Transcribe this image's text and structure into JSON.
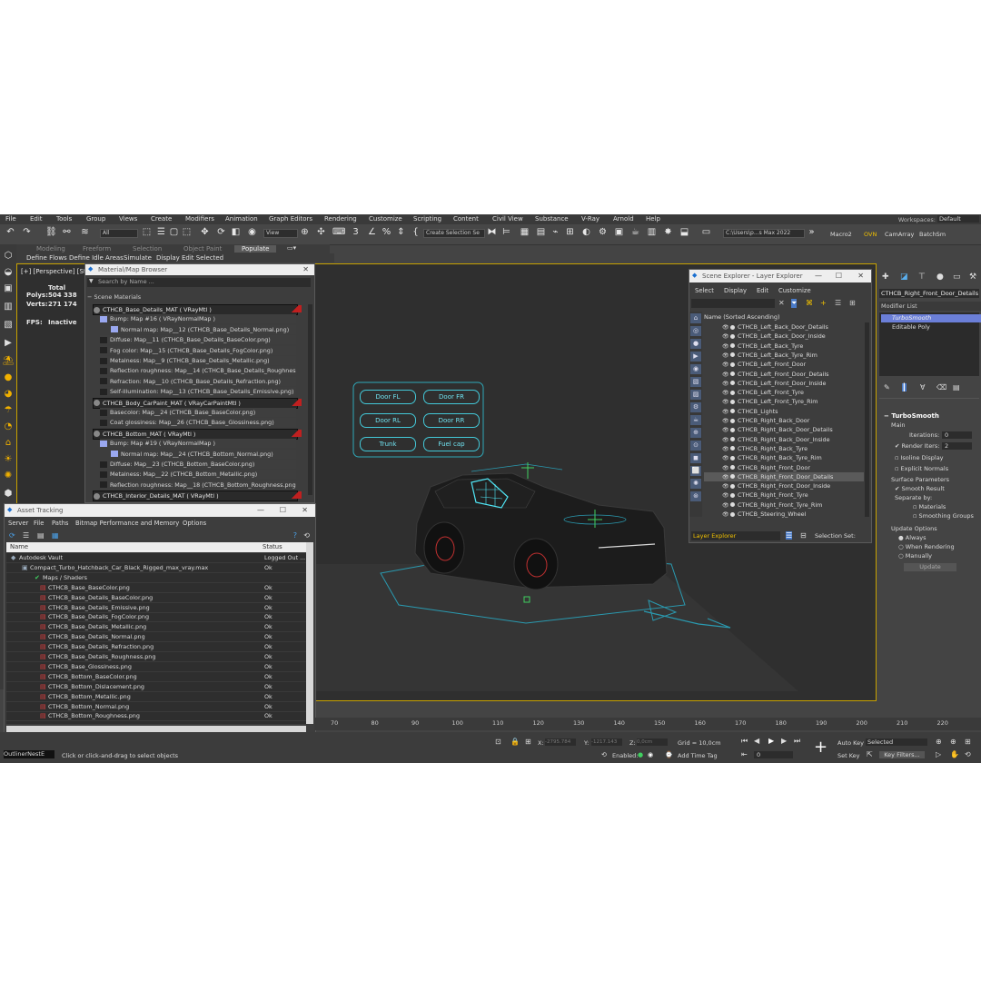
{
  "menu": [
    "File",
    "Edit",
    "Tools",
    "Group",
    "Views",
    "Create",
    "Modifiers",
    "Animation",
    "Graph Editors",
    "Rendering",
    "Customize",
    "Scripting",
    "Content",
    "Civil View",
    "Substance",
    "V-Ray",
    "Arnold",
    "Help"
  ],
  "workspaces": {
    "label": "Workspaces:",
    "value": "Default"
  },
  "toolbar": {
    "filter": "All",
    "refcoord": "View",
    "selset": "Create Selection Se",
    "path": "C:\\Users\\p...s Max 2022",
    "macro": "Macro2",
    "ovn": "OVN",
    "camarray": "CamArray",
    "batchsm": "BatchSm"
  },
  "ribbon": {
    "tabs": [
      "Modeling",
      "Freeform",
      "Selection",
      "Object Paint",
      "Populate"
    ],
    "sub": [
      "Define Flows",
      "Define Idle Areas",
      "Simulate",
      "Display",
      "Edit Selected"
    ]
  },
  "viewport": {
    "label": "[+] [Perspective] [St",
    "stats": {
      "total_label": "Total",
      "polys_label": "Polys:",
      "polys": "504 338",
      "verts_label": "Verts:",
      "verts": "271 174",
      "fps_label": "FPS:",
      "fps": "Inactive"
    },
    "controls": [
      "Door FL",
      "Door FR",
      "Door RL",
      "Door RR",
      "Trunk",
      "Fuel cap"
    ]
  },
  "material_browser": {
    "title": "Material/Map Browser",
    "search_placeholder": "Search by Name ...",
    "group": "Scene Materials",
    "rows": [
      {
        "type": "mat",
        "text": "CTHCB_Base_Details_MAT  ( VRayMtl )"
      },
      {
        "type": "map",
        "text": "Bump: Map #16  ( VRayNormalMap )"
      },
      {
        "type": "map",
        "text": "Normal map: Map__12 (CTHCB_Base_Details_Normal.png)"
      },
      {
        "type": "map",
        "text": "Diffuse: Map__11 (CTHCB_Base_Details_BaseColor.png)"
      },
      {
        "type": "map",
        "text": "Fog color: Map__15 (CTHCB_Base_Details_FogColor.png)"
      },
      {
        "type": "map",
        "text": "Metalness: Map__9 (CTHCB_Base_Details_Metallic.png)"
      },
      {
        "type": "map",
        "text": "Reflection roughness: Map__14 (CTHCB_Base_Details_Roughness..."
      },
      {
        "type": "map",
        "text": "Refraction: Map__10 (CTHCB_Base_Details_Refraction.png)"
      },
      {
        "type": "map",
        "text": "Self-illumination: Map__13 (CTHCB_Base_Details_Emissive.png)"
      },
      {
        "type": "mat",
        "text": "CTHCB_Body_CarPaint_MAT  ( VRayCarPaintMtl )"
      },
      {
        "type": "map",
        "text": "Basecolor: Map__24 (CTHCB_Base_BaseColor.png)"
      },
      {
        "type": "map",
        "text": "Coat glossiness: Map__26 (CTHCB_Base_Glossiness.png)"
      },
      {
        "type": "mat",
        "text": "CTHCB_Bottom_MAT  ( VRayMtl )"
      },
      {
        "type": "map",
        "text": "Bump: Map #19  ( VRayNormalMap )"
      },
      {
        "type": "map",
        "text": "Normal map: Map__24 (CTHCB_Bottom_Normal.png)"
      },
      {
        "type": "map",
        "text": "Diffuse: Map__23 (CTHCB_Bottom_BaseColor.png)"
      },
      {
        "type": "map",
        "text": "Metalness: Map__22 (CTHCB_Bottom_Metallic.png)"
      },
      {
        "type": "map",
        "text": "Reflection roughness: Map__18 (CTHCB_Bottom_Roughness.png)"
      },
      {
        "type": "mat",
        "text": "CTHCB_Interior_Details_MAT  ( VRayMtl )"
      }
    ]
  },
  "asset_tracking": {
    "title": "Asset Tracking",
    "menu": [
      "Server",
      "File",
      "Paths",
      "Bitmap Performance and Memory",
      "Options"
    ],
    "col_name": "Name",
    "col_status": "Status",
    "rows": [
      {
        "name": "Autodesk Vault",
        "status": "Logged Out ..."
      },
      {
        "name": "Compact_Turbo_Hatchback_Car_Black_Rigged_max_vray.max",
        "status": "Ok"
      },
      {
        "name": "Maps / Shaders",
        "status": ""
      },
      {
        "name": "CTHCB_Base_BaseColor.png",
        "status": "Ok"
      },
      {
        "name": "CTHCB_Base_Details_BaseColor.png",
        "status": "Ok"
      },
      {
        "name": "CTHCB_Base_Details_Emissive.png",
        "status": "Ok"
      },
      {
        "name": "CTHCB_Base_Details_FogColor.png",
        "status": "Ok"
      },
      {
        "name": "CTHCB_Base_Details_Metallic.png",
        "status": "Ok"
      },
      {
        "name": "CTHCB_Base_Details_Normal.png",
        "status": "Ok"
      },
      {
        "name": "CTHCB_Base_Details_Refraction.png",
        "status": "Ok"
      },
      {
        "name": "CTHCB_Base_Details_Roughness.png",
        "status": "Ok"
      },
      {
        "name": "CTHCB_Base_Glossiness.png",
        "status": "Ok"
      },
      {
        "name": "CTHCB_Bottom_BaseColor.png",
        "status": "Ok"
      },
      {
        "name": "CTHCB_Bottom_Dislacement.png",
        "status": "Ok"
      },
      {
        "name": "CTHCB_Bottom_Metallic.png",
        "status": "Ok"
      },
      {
        "name": "CTHCB_Bottom_Normal.png",
        "status": "Ok"
      },
      {
        "name": "CTHCB_Bottom_Roughness.png",
        "status": "Ok"
      }
    ]
  },
  "scene_explorer": {
    "title": "Scene Explorer - Layer Explorer",
    "menu": [
      "Select",
      "Display",
      "Edit",
      "Customize"
    ],
    "header": "Name (Sorted Ascending)",
    "selected": "CTHCB_Right_Front_Door_Details",
    "items": [
      "CTHCB_Left_Back_Door_Details",
      "CTHCB_Left_Back_Door_Inside",
      "CTHCB_Left_Back_Tyre",
      "CTHCB_Left_Back_Tyre_Rim",
      "CTHCB_Left_Front_Door",
      "CTHCB_Left_Front_Door_Details",
      "CTHCB_Left_Front_Door_Inside",
      "CTHCB_Left_Front_Tyre",
      "CTHCB_Left_Front_Tyre_Rim",
      "CTHCB_Lights",
      "CTHCB_Right_Back_Door",
      "CTHCB_Right_Back_Door_Details",
      "CTHCB_Right_Back_Door_Inside",
      "CTHCB_Right_Back_Tyre",
      "CTHCB_Right_Back_Tyre_Rim",
      "CTHCB_Right_Front_Door",
      "CTHCB_Right_Front_Door_Details",
      "CTHCB_Right_Front_Door_Inside",
      "CTHCB_Right_Front_Tyre",
      "CTHCB_Right_Front_Tyre_Rim",
      "CTHCB_Steering_Wheel"
    ],
    "footer_layer": "Layer Explorer",
    "footer_selset": "Selection Set:"
  },
  "command_panel": {
    "object_name": "CTHCB_Right_Front_Door_Details",
    "modifier_list": "Modifier List",
    "stack": [
      "TurboSmooth",
      "Editable Poly"
    ],
    "rollout": "TurboSmooth",
    "main": "Main",
    "iterations_label": "Iterations:",
    "iterations": "0",
    "render_iters_label": "Render Iters:",
    "render_iters": "2",
    "isoline": "Isoline Display",
    "explicit": "Explicit Normals",
    "surface": "Surface Parameters",
    "smooth_result": "Smooth Result",
    "separate": "Separate by:",
    "materials": "Materials",
    "smoothing_groups": "Smoothing Groups",
    "update_options": "Update Options",
    "always": "Always",
    "when_rendering": "When Rendering",
    "manually": "Manually",
    "update_btn": "Update"
  },
  "timeline": {
    "ticks": [
      "70",
      "80",
      "90",
      "100",
      "110",
      "120",
      "130",
      "140",
      "150",
      "160",
      "170",
      "180",
      "190",
      "200",
      "210",
      "220"
    ]
  },
  "status": {
    "outliner": "OutlinerNestE",
    "prompt": "Click or click-and-drag to select objects",
    "x_label": "X:",
    "x": "-2795.784",
    "y_label": "Y:",
    "y": "-1217.143",
    "z_label": "Z:",
    "z": "0,0cm",
    "grid": "Grid = 10,0cm",
    "enabled": "Enabled:",
    "add_time_tag": "Add Time Tag",
    "autokey": "Auto Key",
    "setkey": "Set Key",
    "selected": "Selected",
    "keyfilters": "Key Filters...",
    "frame": "0"
  },
  "colors": {
    "accent_yellow": "#c8a200",
    "teal": "#43c8d8",
    "selection_blue": "#6b7fd8"
  }
}
